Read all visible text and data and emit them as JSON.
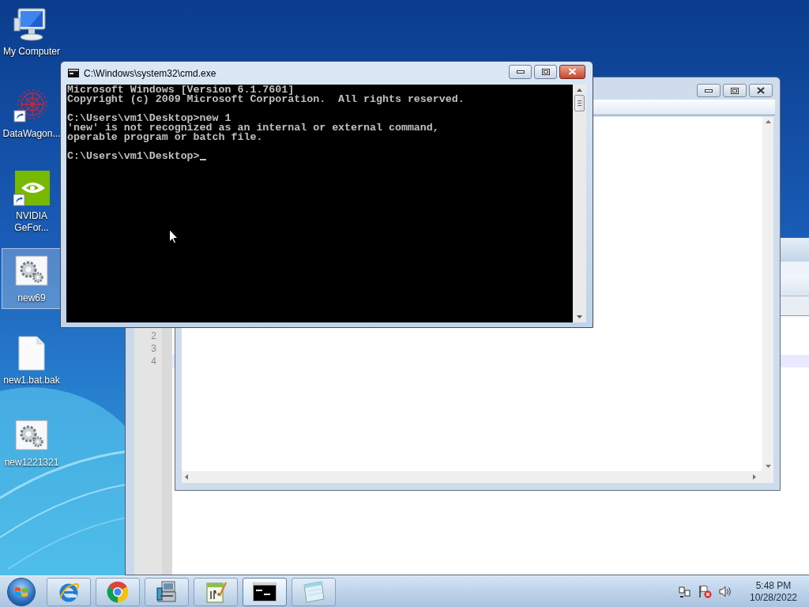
{
  "desktop_icons": [
    {
      "label": "My Computer",
      "kind": "computer",
      "selected": false
    },
    {
      "label": "DataWagon...",
      "kind": "web_shortcut",
      "selected": false
    },
    {
      "label": "NVIDIA GeFor...",
      "kind": "green_shortcut",
      "selected": false
    },
    {
      "label": "new69",
      "kind": "gear_file",
      "selected": true
    },
    {
      "label": "new1.bat.bak",
      "kind": "blank_file",
      "selected": false
    },
    {
      "label": "new1221321",
      "kind": "gear_file",
      "selected": false
    }
  ],
  "editor_window": {
    "lines": [
      {
        "number": "2",
        "current": false
      },
      {
        "number": "3",
        "current": false
      },
      {
        "number": "4",
        "current": true
      }
    ]
  },
  "cmd_window": {
    "title": "C:\\Windows\\system32\\cmd.exe",
    "paragraphs": [
      [
        "Microsoft Windows [Version 6.1.7601]",
        "Copyright (c) 2009 Microsoft Corporation.  All rights reserved."
      ],
      [
        "C:\\Users\\vm1\\Desktop>new 1",
        "'new' is not recognized as an internal or external command,",
        "operable program or batch file."
      ],
      [
        "C:\\Users\\vm1\\Desktop>"
      ]
    ]
  },
  "taskbar": {
    "buttons": [
      {
        "kind": "ie",
        "selected": false
      },
      {
        "kind": "chrome",
        "selected": false
      },
      {
        "kind": "installer",
        "selected": false
      },
      {
        "kind": "notepadpp",
        "selected": false
      },
      {
        "kind": "cmd",
        "selected": true
      },
      {
        "kind": "notes",
        "selected": false
      }
    ],
    "time": "5:48 PM",
    "date": "10/28/2022"
  }
}
